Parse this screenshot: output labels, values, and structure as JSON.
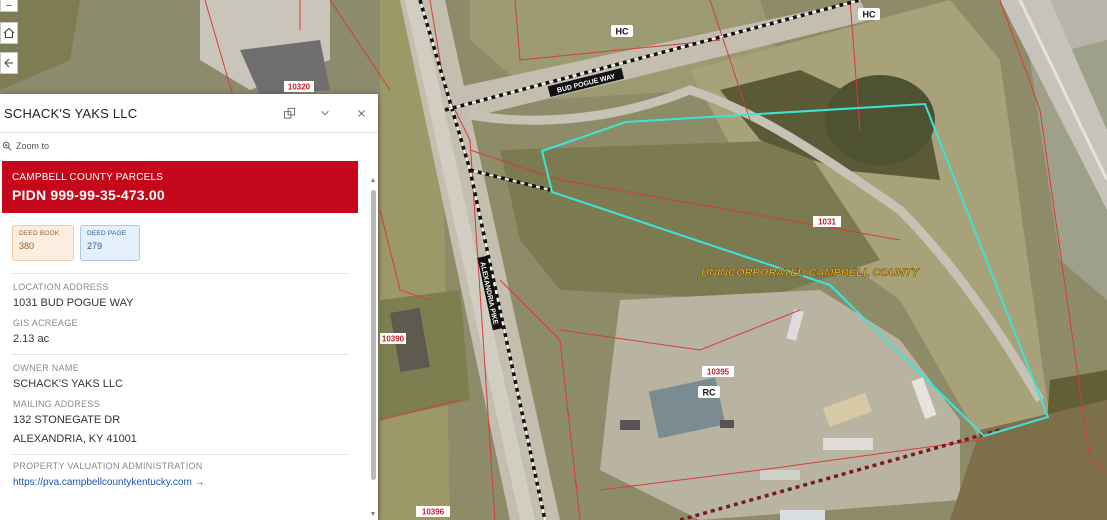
{
  "map": {
    "zoning_labels": [
      "HC",
      "HC",
      "RC"
    ],
    "road_labels": [
      "BUD POGUE WAY",
      "ALEXANDRIA PIKE"
    ],
    "parcel_labels": [
      "10320",
      "1031",
      "10395",
      "10390",
      "10396"
    ],
    "area_label": "UNINCORPORATED CAMPBELL COUNTY",
    "colors": {
      "parcel_line": "#d83a3a",
      "selection_outline": "#3ee3d8",
      "road_dash": "#111111"
    }
  },
  "toolbar": {
    "buttons": [
      {
        "icon": "minus-icon",
        "glyph": "−"
      },
      {
        "icon": "home-icon"
      },
      {
        "icon": "arrow-left-icon"
      }
    ]
  },
  "panel": {
    "title": "SCHACK'S YAKS LLC",
    "header_buttons": [
      "dock-icon",
      "chevron-down-icon",
      "close-icon"
    ],
    "zoom_label": "Zoom to",
    "layer_label": "CAMPBELL COUNTY PARCELS",
    "pidn": "PIDN 999-99-35-473.00",
    "deed_book": {
      "label": "DEED BOOK",
      "value": "380"
    },
    "deed_page": {
      "label": "DEED PAGE",
      "value": "279"
    },
    "location_label": "LOCATION ADDRESS",
    "location_value": "1031 BUD POGUE WAY",
    "acreage_label": "GIS ACREAGE",
    "acreage_value": "2.13 ac",
    "owner_label": "OWNER NAME",
    "owner_value": "SCHACK'S YAKS LLC",
    "mailing_label": "MAILING ADDRESS",
    "mailing_line1": "132 STONEGATE DR",
    "mailing_line2": "ALEXANDRIA, KY 41001",
    "pva_label": "PROPERTY VALUATION ADMINISTRATION",
    "pva_link": "https://pva.campbellcountykentucky.com →"
  }
}
